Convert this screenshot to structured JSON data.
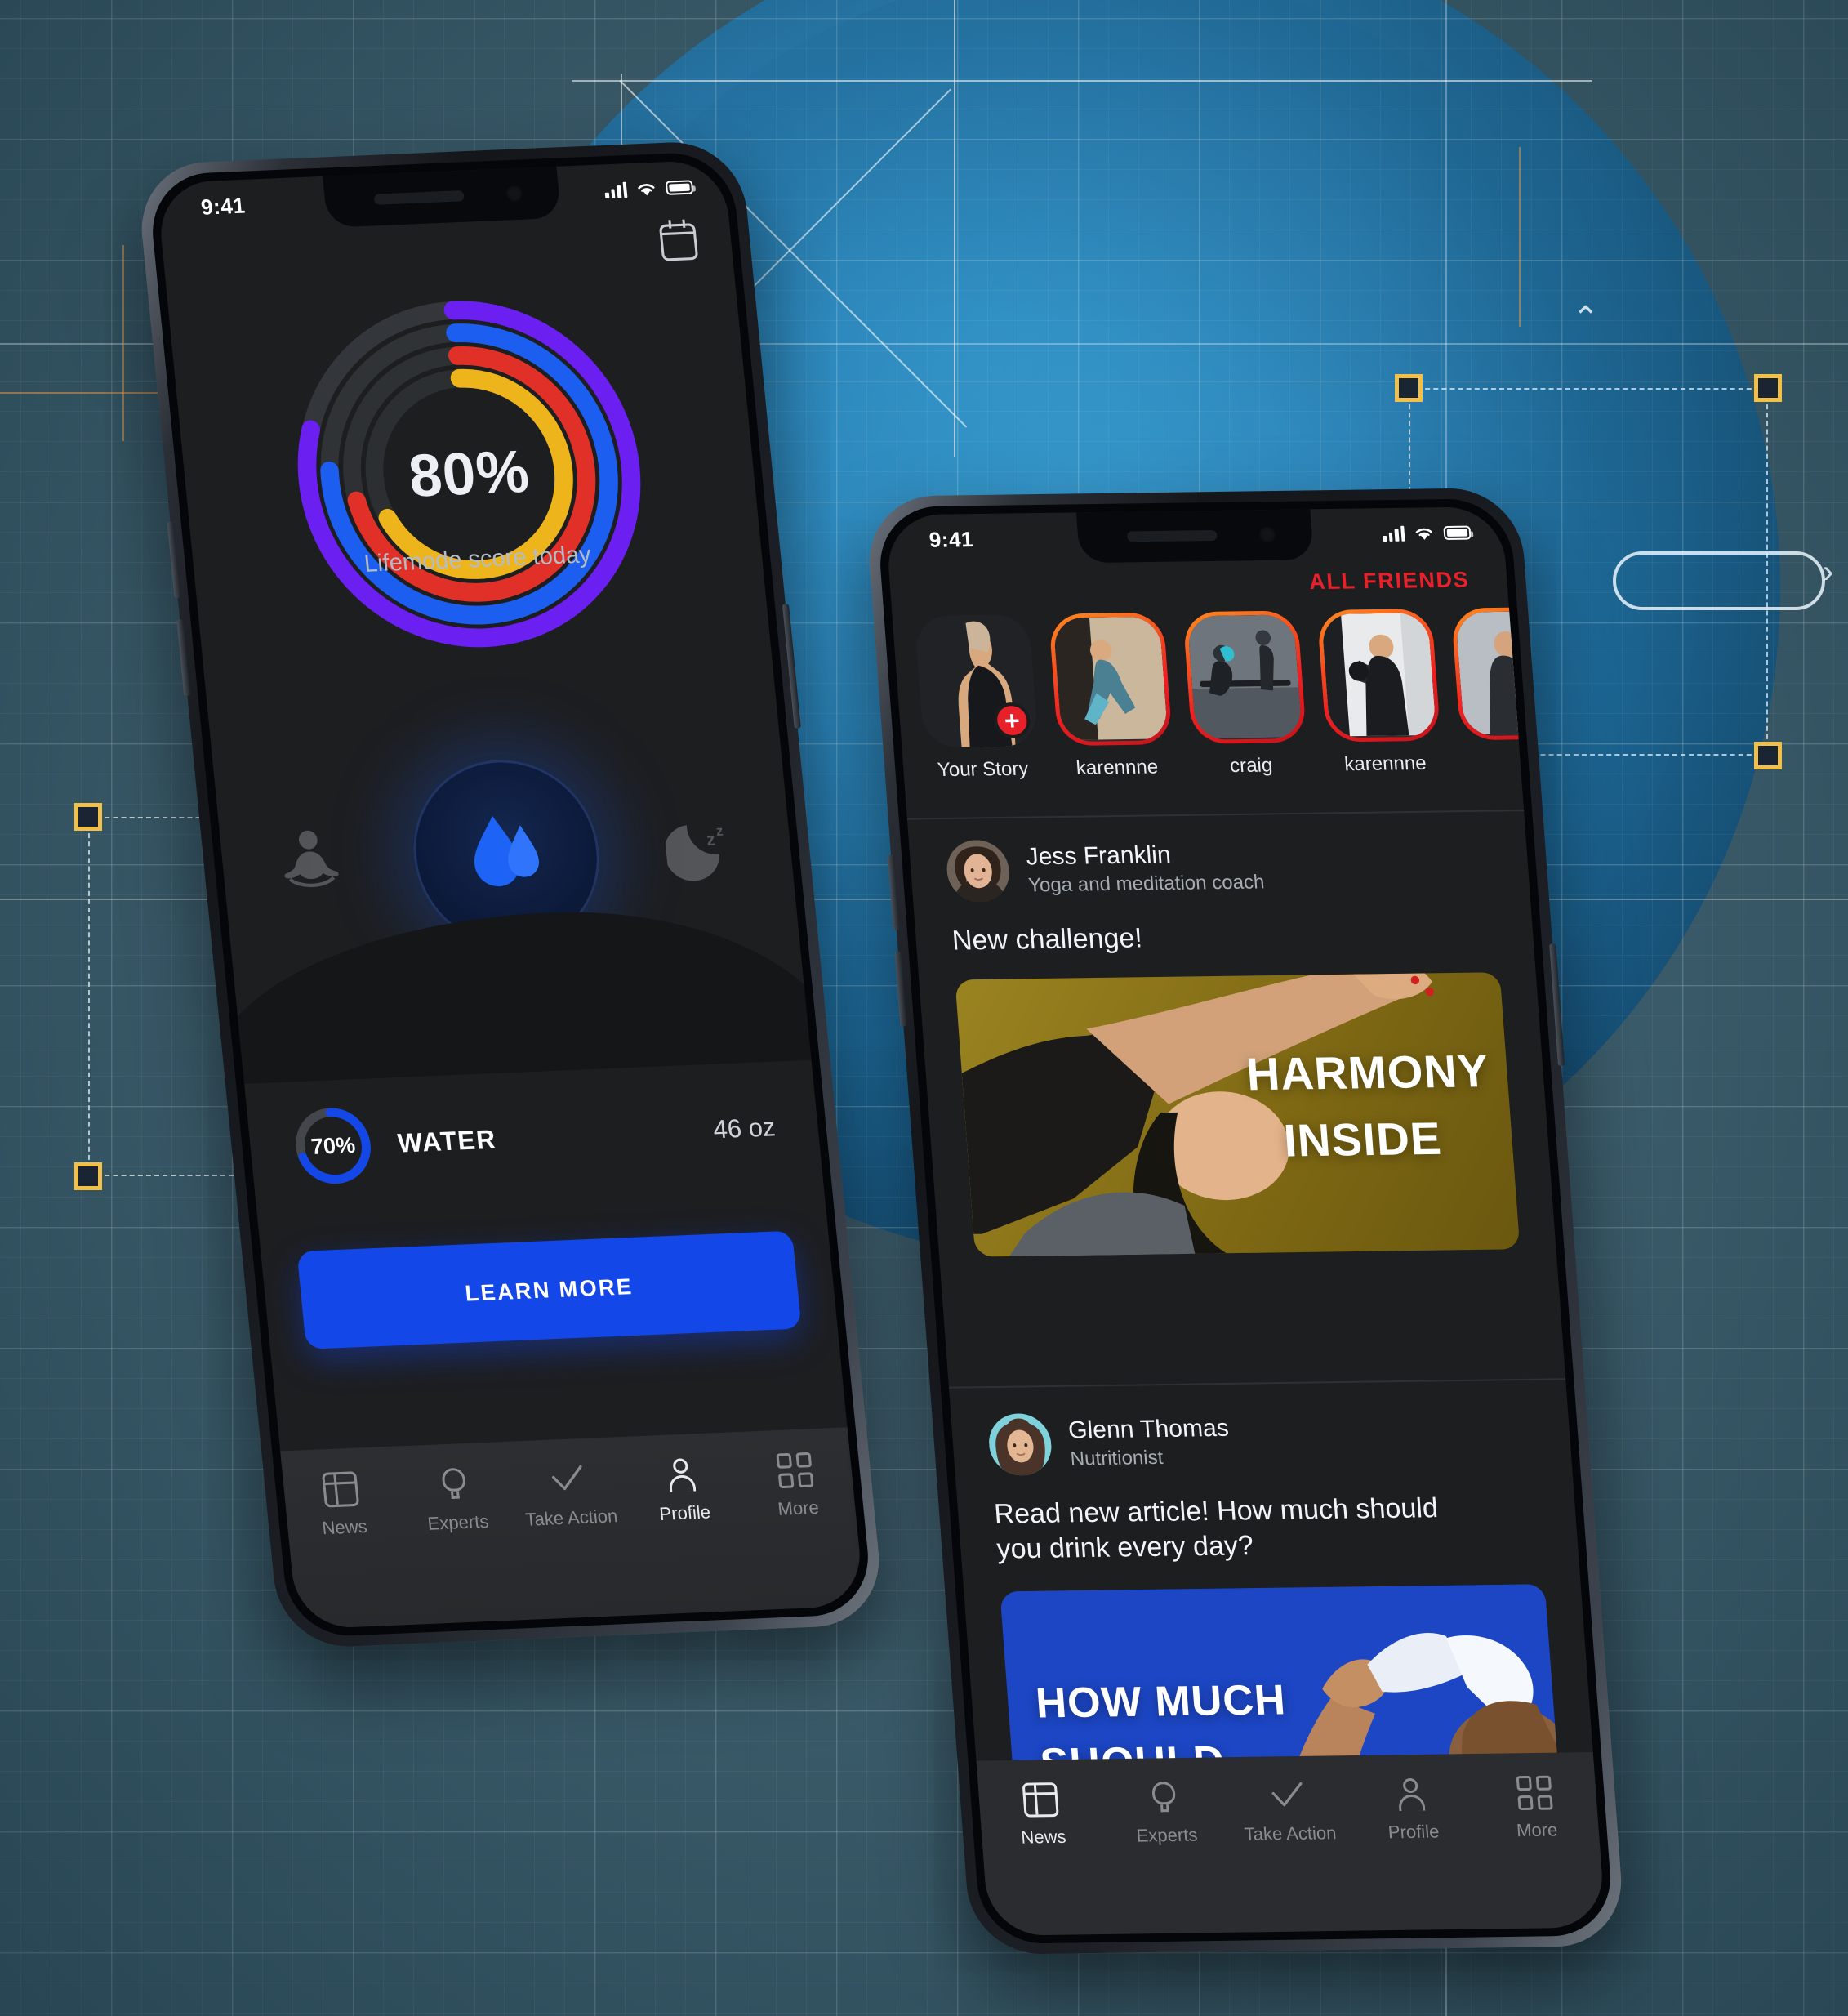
{
  "scene": {
    "background_color": "#3e5f6e",
    "accent_blue": "#2a7fb4",
    "handle_color": "#f0c04a"
  },
  "phone1": {
    "status": {
      "time": "9:41",
      "signal_icon": "signal-bars-icon",
      "wifi_icon": "wifi-icon",
      "battery_icon": "battery-icon"
    },
    "header": {
      "calendar_icon": "calendar-icon"
    },
    "score": {
      "value": "80%",
      "caption": "Lifemode score today",
      "rings": [
        {
          "name": "purple",
          "color": "#6b1ff0",
          "percent": 80
        },
        {
          "name": "blue",
          "color": "#1b5ef0",
          "percent": 76
        },
        {
          "name": "red",
          "color": "#e03028",
          "percent": 72
        },
        {
          "name": "yellow",
          "color": "#edb41c",
          "percent": 68
        }
      ],
      "track_color": "#33363a"
    },
    "modes": [
      {
        "name": "meditation",
        "icon": "meditation-icon",
        "active": false
      },
      {
        "name": "water",
        "icon": "water-drops-icon",
        "active": true
      },
      {
        "name": "sleep",
        "icon": "moon-sleep-icon",
        "active": false
      }
    ],
    "water": {
      "percent": "70%",
      "percent_value": 70,
      "label": "WATER",
      "amount": "46 oz",
      "ring_color": "#1347e8"
    },
    "cta": {
      "label": "LEARN MORE",
      "color": "#1347e8"
    },
    "tabs": [
      {
        "label": "News",
        "icon": "news-icon",
        "active": false
      },
      {
        "label": "Experts",
        "icon": "bulb-icon",
        "active": false
      },
      {
        "label": "Take Action",
        "icon": "check-icon",
        "active": false
      },
      {
        "label": "Profile",
        "icon": "person-icon",
        "active": true
      },
      {
        "label": "More",
        "icon": "grid-icon",
        "active": false
      }
    ]
  },
  "phone2": {
    "status": {
      "time": "9:41",
      "signal_icon": "signal-bars-icon",
      "wifi_icon": "wifi-icon",
      "battery_icon": "battery-icon"
    },
    "all_friends_label": "ALL FRIENDS",
    "all_friends_color": "#e8202a",
    "stories": [
      {
        "name": "Your Story",
        "has_add_badge": true,
        "ring": false
      },
      {
        "name": "karennne",
        "has_add_badge": false,
        "ring": true
      },
      {
        "name": "craig",
        "has_add_badge": false,
        "ring": true
      },
      {
        "name": "karennne",
        "has_add_badge": false,
        "ring": true
      },
      {
        "name": "",
        "has_add_badge": false,
        "ring": true
      }
    ],
    "posts": [
      {
        "author": "Jess Franklin",
        "role": "Yoga and meditation coach",
        "text": "New challenge!",
        "banner": {
          "line1": "HARMONY",
          "line2": "INSIDE",
          "bg": "#8a7318"
        }
      },
      {
        "author": "Glenn Thomas",
        "role": "Nutritionist",
        "text": "Read new article! How much should you drink every day?",
        "banner": {
          "line1": "HOW MUCH",
          "line2": "SHOULD",
          "bg": "#1c46c4"
        }
      }
    ],
    "tabs": [
      {
        "label": "News",
        "icon": "news-icon",
        "active": true
      },
      {
        "label": "Experts",
        "icon": "bulb-icon",
        "active": false
      },
      {
        "label": "Take Action",
        "icon": "check-icon",
        "active": false
      },
      {
        "label": "Profile",
        "icon": "person-icon",
        "active": false
      },
      {
        "label": "More",
        "icon": "grid-icon",
        "active": false
      }
    ]
  }
}
